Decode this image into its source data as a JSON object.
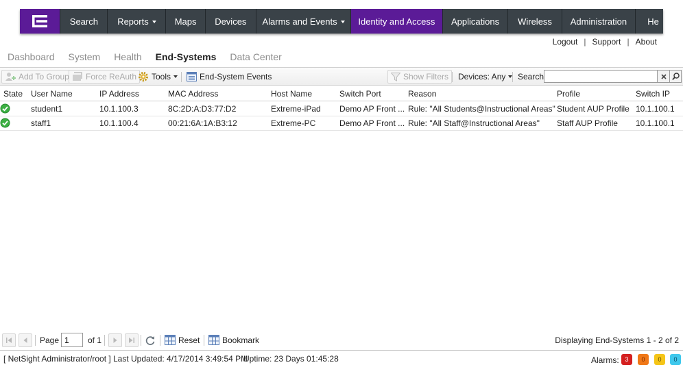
{
  "nav": {
    "items": [
      {
        "label": "Search",
        "caret": false
      },
      {
        "label": "Reports",
        "caret": true
      },
      {
        "label": "Maps",
        "caret": false
      },
      {
        "label": "Devices",
        "caret": false
      },
      {
        "label": "Alarms and Events",
        "caret": true
      },
      {
        "label": "Identity and Access",
        "caret": false,
        "active": true
      },
      {
        "label": "Applications",
        "caret": false
      },
      {
        "label": "Wireless",
        "caret": false
      },
      {
        "label": "Administration",
        "caret": false
      },
      {
        "label": "He",
        "caret": false
      }
    ]
  },
  "top_links": {
    "logout": "Logout",
    "support": "Support",
    "about": "About",
    "separator": "|"
  },
  "subtabs": {
    "dashboard": "Dashboard",
    "system": "System",
    "health": "Health",
    "end_systems": "End-Systems",
    "data_center": "Data Center"
  },
  "toolbar": {
    "add_to_group": "Add To Group",
    "force_reauth": "Force ReAuth",
    "tools": "Tools",
    "end_system_events": "End-System Events",
    "show_filters": "Show Filters",
    "devices": "Devices: Any",
    "search_label": "Search",
    "search_value": ""
  },
  "table": {
    "headers": {
      "state": "State",
      "user_name": "User Name",
      "ip_address": "IP Address",
      "mac_address": "MAC Address",
      "host_name": "Host Name",
      "switch_port": "Switch Port",
      "reason": "Reason",
      "profile": "Profile",
      "switch_ip": "Switch IP"
    },
    "rows": [
      {
        "state": "accepted",
        "user_name": "student1",
        "ip_address": "10.1.100.3",
        "mac_address": "8C:2D:A:D3:77:D2",
        "host_name": "Extreme-iPad",
        "switch_port": "Demo AP Front ...",
        "reason": "Rule: \"All Students@Instructional Areas\"",
        "profile": "Student AUP Profile",
        "switch_ip": "10.1.100.1"
      },
      {
        "state": "accepted",
        "user_name": "staff1",
        "ip_address": "10.1.100.4",
        "mac_address": "00:21:6A:1A:B3:12",
        "host_name": "Extreme-PC",
        "switch_port": "Demo AP Front ...",
        "reason": "Rule: \"All Staff@Instructional Areas\"",
        "profile": "Staff AUP Profile",
        "switch_ip": "10.1.100.1"
      }
    ]
  },
  "pager": {
    "page_label": "Page",
    "page_value": "1",
    "of_label": "of 1",
    "reset": "Reset",
    "bookmark": "Bookmark",
    "display_info": "Displaying End-Systems 1 - 2 of 2"
  },
  "status": {
    "user": "[ NetSight Administrator/root ]",
    "last_updated": "Last Updated: 4/17/2014 3:49:54 PM",
    "uptime": "Uptime: 23 Days 01:45:28",
    "alarms_label": "Alarms:",
    "alarms": [
      {
        "count": "3",
        "color": "#d42020",
        "text_color": "#ffffff"
      },
      {
        "count": "0",
        "color": "#f07818",
        "text_color": "#7a2a00"
      },
      {
        "count": "0",
        "color": "#f5c518",
        "text_color": "#6a5000"
      },
      {
        "count": "0",
        "color": "#3fc8ec",
        "text_color": "#0b4b66"
      }
    ]
  },
  "colors": {
    "brand_purple": "#5b1b97",
    "nav_background": "#3a4248",
    "status_ok": "#3cb043"
  }
}
